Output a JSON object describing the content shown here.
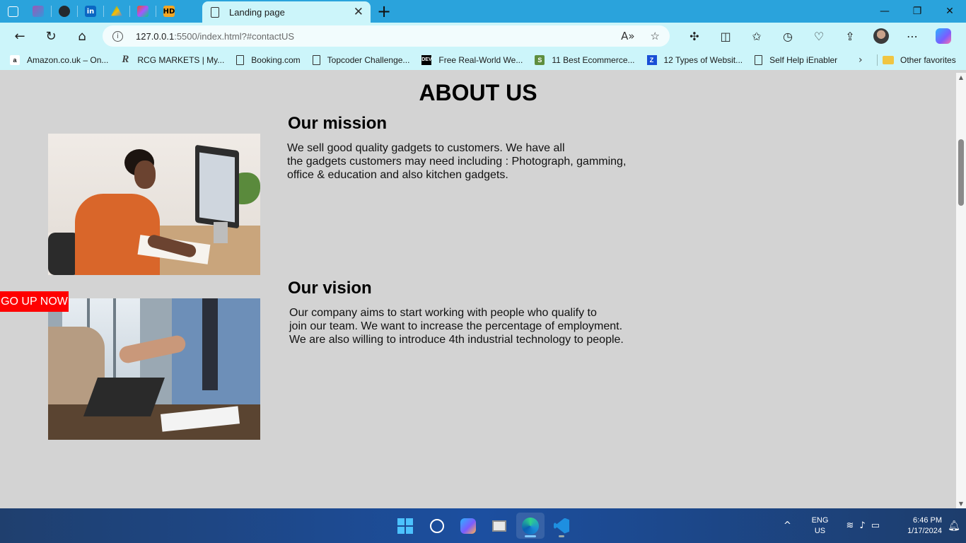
{
  "browser": {
    "tab": {
      "title": "Landing page",
      "close_icon": "✕"
    },
    "new_tab_icon": "+",
    "window_controls": {
      "minimize": "—",
      "restore": "❐",
      "close": "✕"
    },
    "address": {
      "host": "127.0.0.1",
      "path": ":5500/index.html?#contactUS"
    },
    "favorites": [
      {
        "label": "Amazon.co.uk – On...",
        "icon": "amazon-icon",
        "icon_text": "a"
      },
      {
        "label": "RCG MARKETS | My...",
        "icon": "rcg-icon",
        "icon_text": "R"
      },
      {
        "label": "Booking.com",
        "icon": "page-icon",
        "icon_text": ""
      },
      {
        "label": "Topcoder Challenge...",
        "icon": "page-icon",
        "icon_text": ""
      },
      {
        "label": "Free Real-World We...",
        "icon": "dev-icon",
        "icon_text": "DEV"
      },
      {
        "label": "11 Best Ecommerce...",
        "icon": "shopify-icon",
        "icon_text": "S"
      },
      {
        "label": "12 Types of Websit...",
        "icon": "twelve-icon",
        "icon_text": "Z"
      },
      {
        "label": "Self Help iEnabler",
        "icon": "page-icon",
        "icon_text": ""
      }
    ],
    "favorites_more": "›",
    "other_favorites": "Other favorites"
  },
  "page": {
    "title": "ABOUT US",
    "mission": {
      "heading": "Our mission",
      "lines": [
        "We sell good quality gadgets to customers. We have all",
        "the gadgets customers may need including : Photograph, gamming,",
        "office & education and also kitchen gadgets."
      ]
    },
    "vision": {
      "heading": "Our vision",
      "lines": [
        "Our company aims to start working with people who qualify to",
        "join our team. We want to increase the percentage of employment.",
        "We are also willing to introduce 4th industrial technology to people."
      ]
    },
    "go_up_button": "GO UP NOW"
  },
  "taskbar": {
    "language": {
      "line1": "ENG",
      "line2": "US"
    },
    "clock": {
      "time": "6:46 PM",
      "date": "1/17/2024"
    },
    "tray_chevron": "^"
  },
  "colors": {
    "tab_strip": "#2aa3dc",
    "toolbar": "#ccf5fa",
    "page_background": "#d3d3d3",
    "go_up_background": "#ff0000"
  }
}
